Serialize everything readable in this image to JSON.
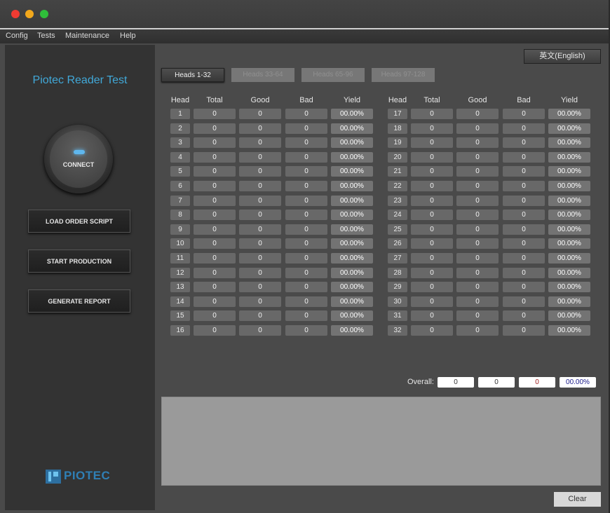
{
  "menu": [
    "Config",
    "Tests",
    "Maintenance",
    "Help"
  ],
  "sidebar": {
    "title": "Piotec Reader Test",
    "connect_label": "CONNECT",
    "buttons": [
      "LOAD ORDER SCRIPT",
      "START PRODUCTION",
      "GENERATE REPORT"
    ],
    "logo_text": "PIOTEC"
  },
  "language_button": "英文(English)",
  "tabs": [
    {
      "label": "Heads 1-32",
      "active": true
    },
    {
      "label": "Heads 33-64",
      "active": false
    },
    {
      "label": "Heads 65-96",
      "active": false
    },
    {
      "label": "Heads 97-128",
      "active": false
    }
  ],
  "table": {
    "headers": [
      "Head",
      "Total",
      "Good",
      "Bad",
      "Yield"
    ],
    "rows": [
      {
        "head": "1",
        "total": "0",
        "good": "0",
        "bad": "0",
        "yield": "00.00%"
      },
      {
        "head": "2",
        "total": "0",
        "good": "0",
        "bad": "0",
        "yield": "00.00%"
      },
      {
        "head": "3",
        "total": "0",
        "good": "0",
        "bad": "0",
        "yield": "00.00%"
      },
      {
        "head": "4",
        "total": "0",
        "good": "0",
        "bad": "0",
        "yield": "00.00%"
      },
      {
        "head": "5",
        "total": "0",
        "good": "0",
        "bad": "0",
        "yield": "00.00%"
      },
      {
        "head": "6",
        "total": "0",
        "good": "0",
        "bad": "0",
        "yield": "00.00%"
      },
      {
        "head": "7",
        "total": "0",
        "good": "0",
        "bad": "0",
        "yield": "00.00%"
      },
      {
        "head": "8",
        "total": "0",
        "good": "0",
        "bad": "0",
        "yield": "00.00%"
      },
      {
        "head": "9",
        "total": "0",
        "good": "0",
        "bad": "0",
        "yield": "00.00%"
      },
      {
        "head": "10",
        "total": "0",
        "good": "0",
        "bad": "0",
        "yield": "00.00%"
      },
      {
        "head": "11",
        "total": "0",
        "good": "0",
        "bad": "0",
        "yield": "00.00%"
      },
      {
        "head": "12",
        "total": "0",
        "good": "0",
        "bad": "0",
        "yield": "00.00%"
      },
      {
        "head": "13",
        "total": "0",
        "good": "0",
        "bad": "0",
        "yield": "00.00%"
      },
      {
        "head": "14",
        "total": "0",
        "good": "0",
        "bad": "0",
        "yield": "00.00%"
      },
      {
        "head": "15",
        "total": "0",
        "good": "0",
        "bad": "0",
        "yield": "00.00%"
      },
      {
        "head": "16",
        "total": "0",
        "good": "0",
        "bad": "0",
        "yield": "00.00%"
      },
      {
        "head": "17",
        "total": "0",
        "good": "0",
        "bad": "0",
        "yield": "00.00%"
      },
      {
        "head": "18",
        "total": "0",
        "good": "0",
        "bad": "0",
        "yield": "00.00%"
      },
      {
        "head": "19",
        "total": "0",
        "good": "0",
        "bad": "0",
        "yield": "00.00%"
      },
      {
        "head": "20",
        "total": "0",
        "good": "0",
        "bad": "0",
        "yield": "00.00%"
      },
      {
        "head": "21",
        "total": "0",
        "good": "0",
        "bad": "0",
        "yield": "00.00%"
      },
      {
        "head": "22",
        "total": "0",
        "good": "0",
        "bad": "0",
        "yield": "00.00%"
      },
      {
        "head": "23",
        "total": "0",
        "good": "0",
        "bad": "0",
        "yield": "00.00%"
      },
      {
        "head": "24",
        "total": "0",
        "good": "0",
        "bad": "0",
        "yield": "00.00%"
      },
      {
        "head": "25",
        "total": "0",
        "good": "0",
        "bad": "0",
        "yield": "00.00%"
      },
      {
        "head": "26",
        "total": "0",
        "good": "0",
        "bad": "0",
        "yield": "00.00%"
      },
      {
        "head": "27",
        "total": "0",
        "good": "0",
        "bad": "0",
        "yield": "00.00%"
      },
      {
        "head": "28",
        "total": "0",
        "good": "0",
        "bad": "0",
        "yield": "00.00%"
      },
      {
        "head": "29",
        "total": "0",
        "good": "0",
        "bad": "0",
        "yield": "00.00%"
      },
      {
        "head": "30",
        "total": "0",
        "good": "0",
        "bad": "0",
        "yield": "00.00%"
      },
      {
        "head": "31",
        "total": "0",
        "good": "0",
        "bad": "0",
        "yield": "00.00%"
      },
      {
        "head": "32",
        "total": "0",
        "good": "0",
        "bad": "0",
        "yield": "00.00%"
      }
    ]
  },
  "overall": {
    "label": "Overall:",
    "total": "0",
    "good": "0",
    "bad": "0",
    "yield": "00.00%",
    "bad_color": "#a02020",
    "yield_color": "#1a1a8a"
  },
  "clear_button": "Clear",
  "colors": {
    "accent": "#41a8d8",
    "led": "#5fb7ee"
  }
}
